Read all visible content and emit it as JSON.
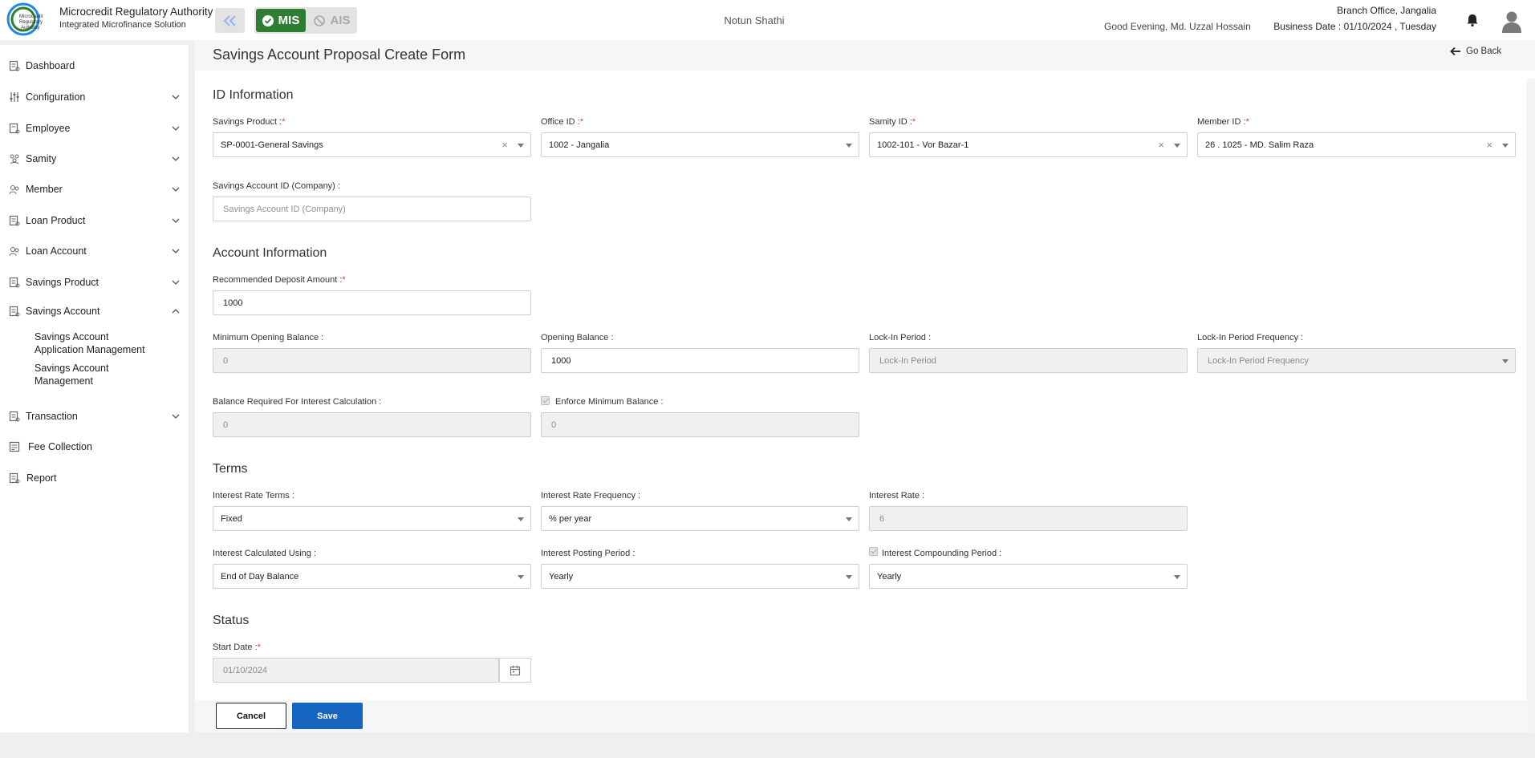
{
  "header": {
    "logo_text": "Microcredit Regulatory Authority",
    "brand_title": "Microcredit Regulatory Authority",
    "brand_subtitle": "Integrated Microfinance Solution",
    "mis_label": "MIS",
    "ais_label": "AIS",
    "org_name": "Notun Shathi",
    "greeting": "Good Evening, Md. Uzzal Hossain",
    "branch": "Branch Office, Jangalia",
    "business_date": "Business Date : 01/10/2024 , Tuesday"
  },
  "sidebar": {
    "items": [
      {
        "label": "Dashboard",
        "icon": "dashboard-icon"
      },
      {
        "label": "Configuration",
        "icon": "configuration-icon"
      },
      {
        "label": "Employee",
        "icon": "employee-icon"
      },
      {
        "label": "Samity",
        "icon": "samity-icon"
      },
      {
        "label": "Member",
        "icon": "member-icon"
      },
      {
        "label": "Loan Product",
        "icon": "loan-product-icon"
      },
      {
        "label": "Loan Account",
        "icon": "loan-account-icon"
      },
      {
        "label": "Savings Product",
        "icon": "savings-product-icon"
      },
      {
        "label": "Savings Account",
        "icon": "savings-account-icon"
      },
      {
        "label": "Transaction",
        "icon": "transaction-icon"
      },
      {
        "label": "Fee Collection",
        "icon": "fee-collection-icon"
      },
      {
        "label": "Report",
        "icon": "report-icon"
      }
    ],
    "subitems": [
      "Savings Account\nApplication Management",
      "Savings Account\nManagement"
    ]
  },
  "page": {
    "title": "Savings Account Proposal Create Form",
    "go_back": "Go Back"
  },
  "sections": {
    "id_info": "ID Information",
    "account_info": "Account Information",
    "terms": "Terms",
    "status": "Status"
  },
  "fields": {
    "savings_product": {
      "label": "Savings Product :",
      "value": "SP-0001-General Savings"
    },
    "office_id": {
      "label": "Office ID :",
      "value": "1002 - Jangalia"
    },
    "samity_id": {
      "label": "Samity ID :",
      "value": "1002-101 - Vor Bazar-1"
    },
    "member_id": {
      "label": "Member ID :",
      "value": "26 . 1025 - MD. Salim Raza"
    },
    "savings_account_id": {
      "label": "Savings Account ID (Company) :",
      "placeholder": "Savings Account ID (Company)"
    },
    "recommended_deposit": {
      "label": "Recommended Deposit Amount :",
      "value": "1000"
    },
    "min_opening_balance": {
      "label": "Minimum Opening Balance :",
      "value": "0"
    },
    "opening_balance": {
      "label": "Opening Balance :",
      "value": "1000"
    },
    "lock_in_period": {
      "label": "Lock-In Period :",
      "placeholder": "Lock-In Period"
    },
    "lock_in_frequency": {
      "label": "Lock-In Period Frequency :",
      "placeholder": "Lock-In Period Frequency"
    },
    "balance_required": {
      "label": "Balance Required For Interest Calculation :",
      "value": "0"
    },
    "enforce_min_balance": {
      "label": "Enforce Minimum Balance :",
      "value": "0"
    },
    "interest_rate_terms": {
      "label": "Interest Rate Terms :",
      "value": "Fixed"
    },
    "interest_rate_frequency": {
      "label": "Interest Rate Frequency :",
      "value": "% per year"
    },
    "interest_rate": {
      "label": "Interest Rate :",
      "value": "6"
    },
    "interest_calc_using": {
      "label": "Interest Calculated Using :",
      "value": "End of Day Balance"
    },
    "interest_posting_period": {
      "label": "Interest Posting Period :",
      "value": "Yearly"
    },
    "interest_compounding_period": {
      "label": "Interest Compounding Period :",
      "value": "Yearly"
    },
    "start_date": {
      "label": "Start Date :",
      "value": "01/10/2024"
    }
  },
  "required_mark": "*",
  "actions": {
    "cancel": "Cancel",
    "save": "Save"
  },
  "colors": {
    "accent": "#1565c0",
    "mis_green": "#2e7d32",
    "required": "#e53935"
  }
}
